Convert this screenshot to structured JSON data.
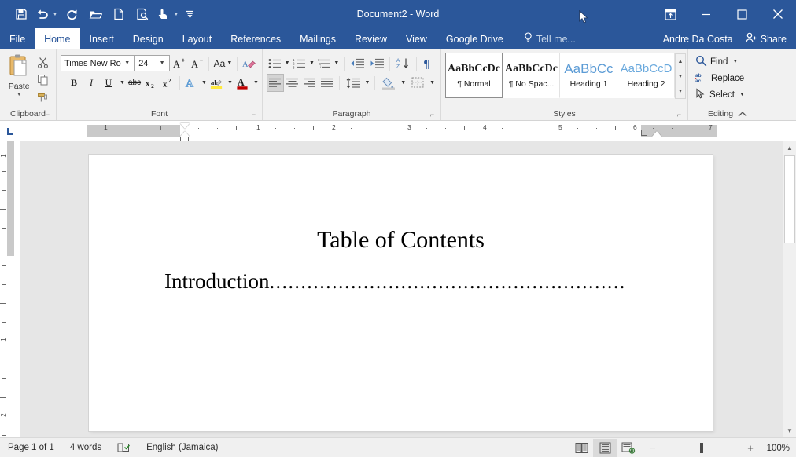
{
  "window": {
    "title": "Document2 - Word",
    "controls": {
      "ribbon_display_options": "ribbon-display-options",
      "minimize": "—",
      "maximize": "□",
      "close": "✕"
    }
  },
  "quick_access": [
    {
      "name": "save",
      "label": "Save"
    },
    {
      "name": "undo",
      "label": "Undo",
      "has_dropdown": true
    },
    {
      "name": "redo",
      "label": "Redo"
    },
    {
      "name": "open",
      "label": "Open"
    },
    {
      "name": "new",
      "label": "New"
    },
    {
      "name": "print-preview",
      "label": "Print Preview and Print"
    },
    {
      "name": "touch-mouse-mode",
      "label": "Touch/Mouse Mode",
      "has_dropdown": true
    },
    {
      "name": "customize-quick-access-toolbar",
      "label": "Customize Quick Access Toolbar"
    }
  ],
  "tabs": [
    {
      "label": "File",
      "active": false
    },
    {
      "label": "Home",
      "active": true
    },
    {
      "label": "Insert",
      "active": false
    },
    {
      "label": "Design",
      "active": false
    },
    {
      "label": "Layout",
      "active": false
    },
    {
      "label": "References",
      "active": false
    },
    {
      "label": "Mailings",
      "active": false
    },
    {
      "label": "Review",
      "active": false
    },
    {
      "label": "View",
      "active": false
    },
    {
      "label": "Google Drive",
      "active": false
    }
  ],
  "tell_me": {
    "placeholder": "Tell me..."
  },
  "account": {
    "name": "Andre Da Costa"
  },
  "share": {
    "label": "Share"
  },
  "ribbon": {
    "groups": [
      {
        "name": "clipboard",
        "label": "Clipboard"
      },
      {
        "name": "font",
        "label": "Font"
      },
      {
        "name": "paragraph",
        "label": "Paragraph"
      },
      {
        "name": "styles",
        "label": "Styles"
      },
      {
        "name": "editing",
        "label": "Editing"
      }
    ],
    "clipboard": {
      "paste_label": "Paste",
      "cut": "Cut",
      "copy": "Copy",
      "format_painter": "Format Painter"
    },
    "font": {
      "font_name": "Times New Ro",
      "font_name_full": "Times New Roman",
      "font_size": "24",
      "grow_font": "A",
      "shrink_font": "A",
      "change_case": "Aa",
      "clear_formatting": "clear-formatting",
      "bold": "B",
      "italic": "I",
      "underline": "U",
      "strikethrough": "abc",
      "subscript": "x",
      "superscript": "x",
      "text_effects": "A",
      "highlight": "ab",
      "font_color": "A"
    },
    "paragraph": {
      "bullets": "bullets",
      "numbering": "numbering",
      "multilevel_list": "multilevel-list",
      "decrease_indent": "decrease-indent",
      "increase_indent": "increase-indent",
      "sort": "sort",
      "show_formatting_marks": "¶",
      "align_left": "align-left",
      "align_center": "align-center",
      "align_right": "align-right",
      "justify": "justify",
      "line_spacing": "line-spacing",
      "shading": "shading",
      "borders": "borders"
    },
    "styles": {
      "items": [
        {
          "preview": "AaBbCcDc",
          "name": "¶ Normal",
          "kind": "normal",
          "selected": true
        },
        {
          "preview": "AaBbCcDc",
          "name": "¶ No Spac...",
          "kind": "normal",
          "selected": false
        },
        {
          "preview": "AaBbCс",
          "name": "Heading 1",
          "kind": "h1",
          "selected": false
        },
        {
          "preview": "AaBbCcD",
          "name": "Heading 2",
          "kind": "h2",
          "selected": false
        }
      ]
    },
    "editing": {
      "find": "Find",
      "replace": "Replace",
      "select": "Select"
    }
  },
  "ruler": {
    "horizontal_numbers": [
      "1",
      "1",
      "2",
      "3",
      "4",
      "5",
      "6",
      "7"
    ],
    "vertical_numbers": [
      "1",
      "1",
      "2"
    ],
    "tab_selector": "left-tab-stop"
  },
  "document": {
    "title": "Table of Contents",
    "entry_text": "Introduction",
    "entry_leader": "........................................................."
  },
  "status_bar": {
    "page": "Page 1 of 1",
    "words": "4 words",
    "proofing": "proofing-errors-icon",
    "language": "English (Jamaica)",
    "views": [
      {
        "name": "read-mode",
        "active": false
      },
      {
        "name": "print-layout",
        "active": true
      },
      {
        "name": "web-layout",
        "active": false
      }
    ],
    "zoom_out": "−",
    "zoom_in": "+",
    "zoom_level": "100%"
  },
  "colors": {
    "brand": "#2b579a",
    "ribbon_bg": "#f1f1f1",
    "canvas_bg": "#e6e6e6",
    "heading_blue": "#5b9bd5"
  }
}
